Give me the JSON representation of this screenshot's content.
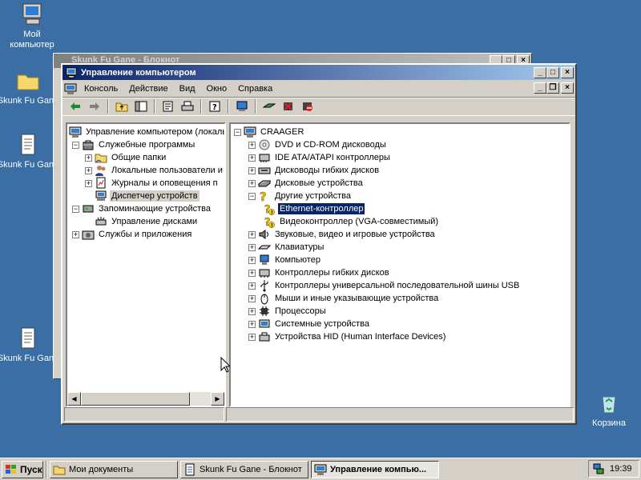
{
  "desktop": {
    "icons": [
      {
        "label1": "Мой",
        "label2": "компьютер"
      },
      {
        "label1": "Skunk Fu Gane",
        "label2": ""
      },
      {
        "label1": "Skunk Fu Gane",
        "label2": ""
      },
      {
        "label1": "Skunk Fu Gane",
        "label2": ""
      },
      {
        "label1": "Корзина",
        "label2": ""
      }
    ]
  },
  "notepad": {
    "title": "Skunk Fu Gane - Блокнот"
  },
  "window": {
    "title": "Управление компьютером",
    "menu": [
      "Консоль",
      "Действие",
      "Вид",
      "Окно",
      "Справка"
    ]
  },
  "left_tree": {
    "root": "Управление компьютером (локаль",
    "items": [
      "Служебные программы",
      "Общие папки",
      "Локальные пользователи и",
      "Журналы и оповещения п",
      "Диспетчер устройств",
      "Запоминающие устройства",
      "Управление дисками",
      "Службы и приложения"
    ]
  },
  "right_tree": {
    "root": "CRAAGER",
    "items": [
      "DVD и CD-ROM дисководы",
      "IDE ATA/ATAPI контроллеры",
      "Дисководы гибких дисков",
      "Дисковые устройства",
      "Другие устройства",
      "Ethernet-контроллер",
      "Видеоконтроллер (VGA-совместимый)",
      "Звуковые, видео и игровые устройства",
      "Клавиатуры",
      "Компьютер",
      "Контроллеры гибких дисков",
      "Контроллеры универсальной последовательной шины USB",
      "Мыши и иные указывающие устройства",
      "Процессоры",
      "Системные устройства",
      "Устройства HID (Human Interface Devices)"
    ]
  },
  "taskbar": {
    "start": "Пуск",
    "tasks": [
      "Мои документы",
      "Skunk Fu Gane - Блокнот",
      "Управление компью..."
    ],
    "clock": "19:39"
  },
  "colors": {
    "desktop": "#3a6ea5",
    "titlebar_active": "#0a246a",
    "selection": "#0a246a"
  }
}
